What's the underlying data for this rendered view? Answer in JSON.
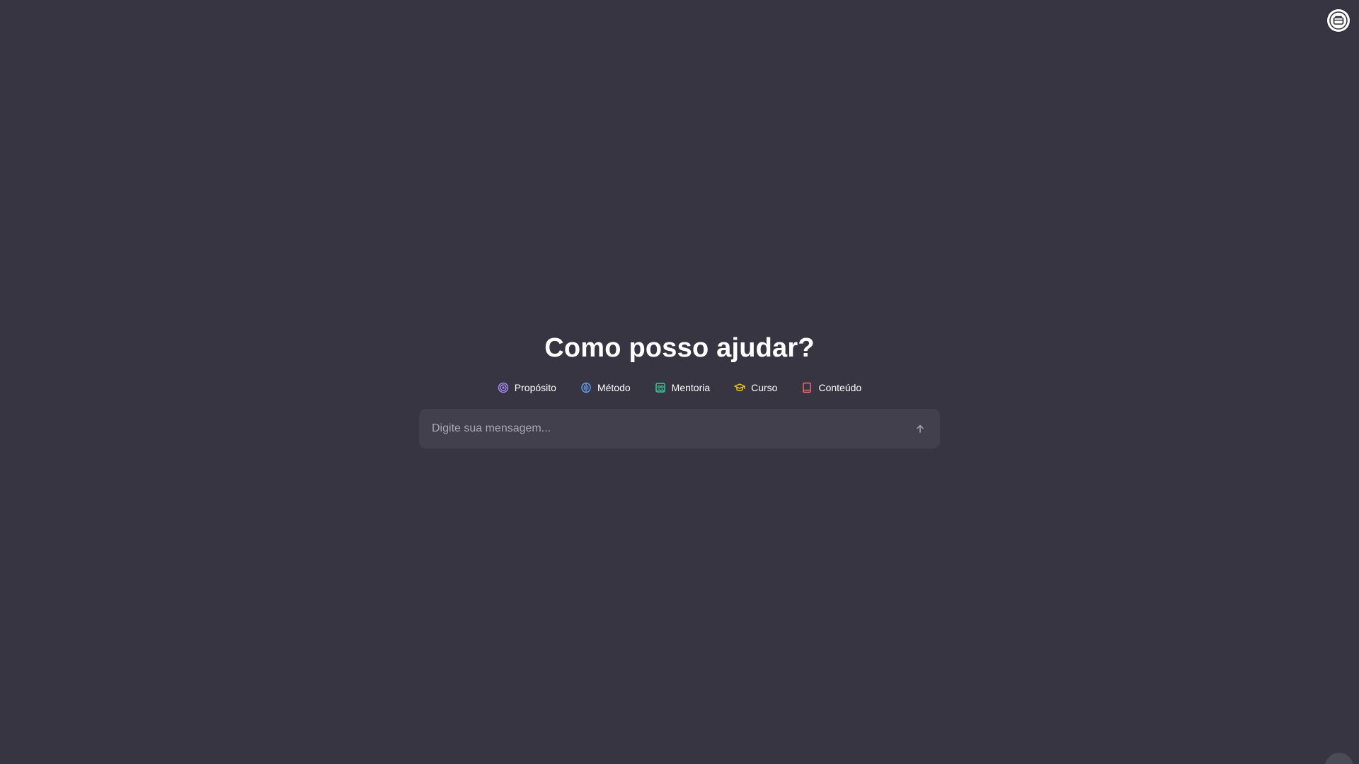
{
  "heading": "Como posso ajudar?",
  "chips": [
    {
      "label": "Propósito",
      "icon": "target-icon",
      "color": "#a78bfa"
    },
    {
      "label": "Método",
      "icon": "brain-icon",
      "color": "#60a5fa"
    },
    {
      "label": "Mentoria",
      "icon": "users-board-icon",
      "color": "#34d399"
    },
    {
      "label": "Curso",
      "icon": "graduation-cap-icon",
      "color": "#facc15"
    },
    {
      "label": "Conteúdo",
      "icon": "book-icon",
      "color": "#f87171"
    }
  ],
  "composer": {
    "placeholder": "Digite sua mensagem...",
    "value": ""
  },
  "colors": {
    "background": "#363541",
    "composer_bg": "#41404c"
  }
}
